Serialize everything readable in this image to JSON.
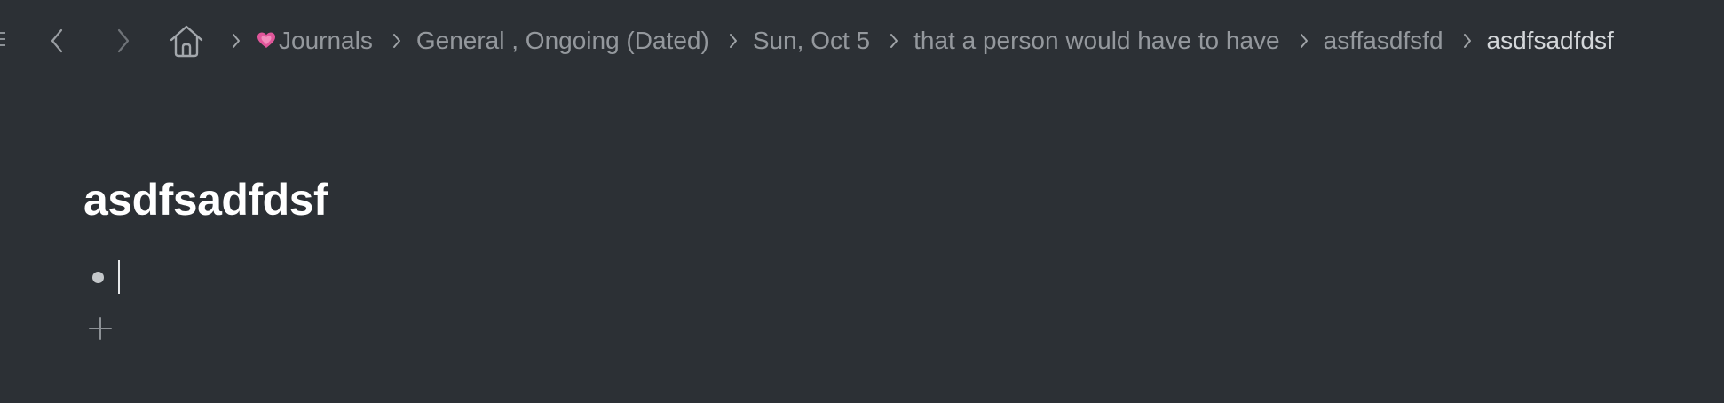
{
  "toolbar": {
    "sidebar_toggle_icon": "sidebar-toggle-icon",
    "back_icon": "chevron-left-icon",
    "forward_icon": "chevron-right-icon",
    "home_icon": "home-icon"
  },
  "breadcrumb": {
    "separator_icon": "chevron-right-icon",
    "emoji_icon": "heart-emoji-icon",
    "items": [
      {
        "label": "Journals"
      },
      {
        "label": "General , Ongoing (Dated)"
      },
      {
        "label": "Sun, Oct 5"
      },
      {
        "label": "that a person would have to have"
      },
      {
        "label": "asffasdfsfd"
      },
      {
        "label": "asdfsadfdsf"
      }
    ]
  },
  "page": {
    "title": "asdfsadfdsf",
    "blocks": [
      {
        "text": ""
      }
    ],
    "add_icon": "plus-icon"
  },
  "colors": {
    "background": "#2c3035",
    "crumb_text": "#94989d",
    "crumb_current": "#d4d7da",
    "title": "#ffffff",
    "heart": "#e0569a"
  }
}
